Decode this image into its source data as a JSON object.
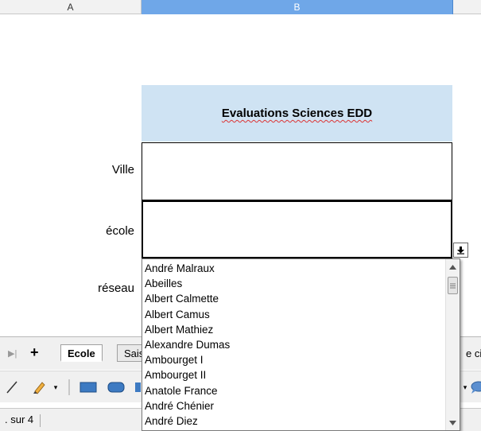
{
  "columns": {
    "a": "A",
    "b": "B"
  },
  "title": "Evaluations Sciences EDD",
  "labels": {
    "ville": "Ville",
    "ecole": "école",
    "reseau": "réseau"
  },
  "cells": {
    "ville_value": "",
    "ecole_value": ""
  },
  "dropdown": {
    "items": [
      "André Malraux",
      "Abeilles",
      "Albert Calmette",
      "Albert Camus",
      "Albert Mathiez",
      "Alexandre Dumas",
      "Ambourget I",
      "Ambourget II",
      "Anatole France",
      "André Chénier",
      "André Diez"
    ]
  },
  "tabs": {
    "add": "+",
    "sheets": [
      "Ecole",
      "Sais"
    ],
    "right_partial": "e cir"
  },
  "status": {
    "page_text": ". sur 4"
  },
  "colors": {
    "title_fill": "#cfe3f3",
    "selected_column": "#6fa7e8",
    "chrome": "#f0f0f0"
  },
  "icons": [
    "line-icon",
    "pen-color-icon",
    "rectangle-icon",
    "rounded-rectangle-icon",
    "dropdown-arrow-icon",
    "callout-icon"
  ]
}
